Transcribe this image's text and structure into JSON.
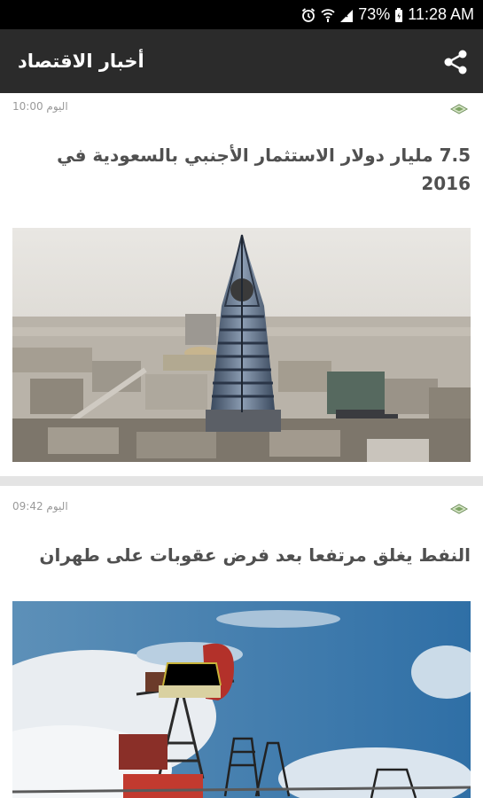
{
  "status_bar": {
    "battery": "73%",
    "time": "11:28 AM",
    "icons": [
      "alarm-icon",
      "wifi-icon",
      "signal-icon",
      "battery-icon"
    ]
  },
  "app_bar": {
    "title": "أخبار الاقتصاد",
    "share_icon": "share-icon"
  },
  "articles": [
    {
      "time": "اليوم 10:00",
      "headline": "7.5 مليار دولار الاستثمار الأجنبي بالسعودية في 2016",
      "source_icon": "news-source-icon"
    },
    {
      "time": "اليوم 09:42",
      "headline": "النفط يغلق مرتفعا بعد فرض عقوبات على طهران",
      "source_icon": "news-source-icon"
    }
  ],
  "colors": {
    "app_bar": "#2b2b2b",
    "status_bar": "#000000",
    "background": "#e4e4e4",
    "headline": "#505050"
  }
}
